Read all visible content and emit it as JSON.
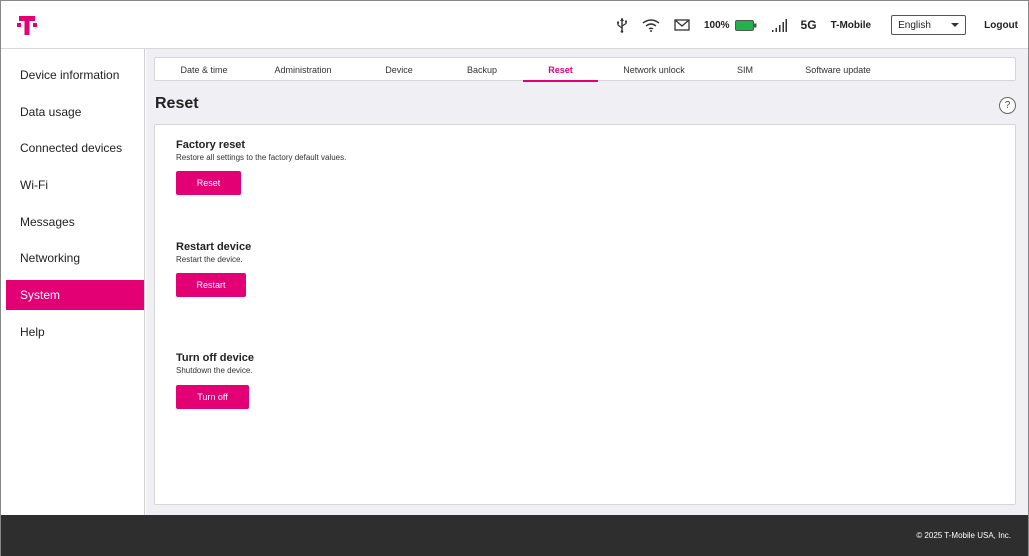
{
  "header": {
    "battery_text": "100%",
    "network_type": "5G",
    "carrier": "T-Mobile",
    "language": {
      "selected": "English"
    },
    "logout_label": "Logout",
    "icons": [
      "t-mobile-logo",
      "usb-icon",
      "wifi-icon",
      "mail-icon",
      "battery-icon",
      "signal-icon"
    ],
    "brand_color": "#e20074",
    "battery_color": "#22b14c"
  },
  "sidebar": {
    "items": [
      {
        "label": "Device information"
      },
      {
        "label": "Data usage"
      },
      {
        "label": "Connected devices"
      },
      {
        "label": "Wi-Fi"
      },
      {
        "label": "Messages"
      },
      {
        "label": "Networking"
      },
      {
        "label": "System",
        "active": true
      },
      {
        "label": "Help"
      }
    ]
  },
  "tabs": [
    {
      "label": "Date & time"
    },
    {
      "label": "Administration"
    },
    {
      "label": "Device"
    },
    {
      "label": "Backup"
    },
    {
      "label": "Reset",
      "active": true
    },
    {
      "label": "Network unlock"
    },
    {
      "label": "SIM"
    },
    {
      "label": "Software update"
    }
  ],
  "page": {
    "title": "Reset",
    "help_label": "?",
    "sections": [
      {
        "title": "Factory reset",
        "description": "Restore all settings to the factory default values.",
        "button": "Reset"
      },
      {
        "title": "Restart device",
        "description": "Restart the device.",
        "button": "Restart"
      },
      {
        "title": "Turn off device",
        "description": "Shutdown the device.",
        "button": "Turn off"
      }
    ]
  },
  "footer": {
    "copyright": "© 2025 T-Mobile USA, Inc."
  }
}
